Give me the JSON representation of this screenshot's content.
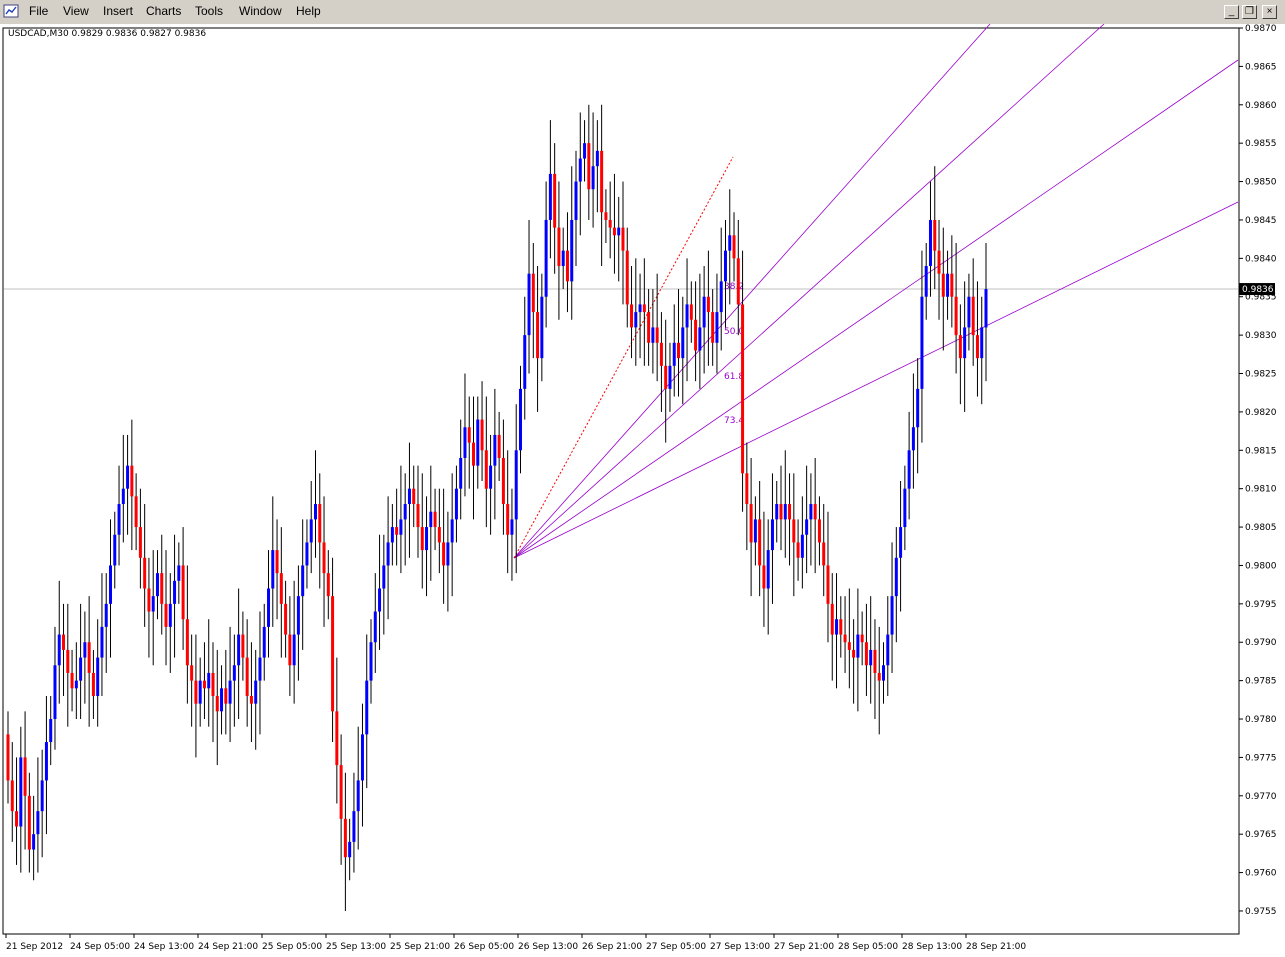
{
  "menu": {
    "items": [
      "File",
      "View",
      "Insert",
      "Charts",
      "Tools",
      "Window",
      "Help"
    ]
  },
  "window_controls": {
    "minimize": "_",
    "restore": "❐",
    "close": "×"
  },
  "chart": {
    "symbol_info": "USDCAD,M30  0.9829 0.9836 0.9827 0.9836",
    "current_price_label": "0.9836",
    "current_price": 0.9836
  },
  "colors": {
    "bull": "#0000ff",
    "bear": "#ff0000",
    "fib": "#9900cc",
    "trend": "#ff0000",
    "grid_line": "#c0c0c0"
  },
  "chart_data": {
    "type": "candlestick",
    "symbol": "USDCAD",
    "timeframe": "M30",
    "ylim": [
      0.9752,
      0.987
    ],
    "yticks": [
      "0.9870",
      "0.9865",
      "0.9860",
      "0.9855",
      "0.9850",
      "0.9845",
      "0.9840",
      "0.9835",
      "0.9830",
      "0.9825",
      "0.9820",
      "0.9815",
      "0.9810",
      "0.9805",
      "0.9800",
      "0.9795",
      "0.9790",
      "0.9785",
      "0.9780",
      "0.9775",
      "0.9770",
      "0.9765",
      "0.9760",
      "0.9755"
    ],
    "xticks": [
      "21 Sep 2012",
      "24 Sep 05:00",
      "24 Sep 13:00",
      "24 Sep 21:00",
      "25 Sep 05:00",
      "25 Sep 13:00",
      "25 Sep 21:00",
      "26 Sep 05:00",
      "26 Sep 13:00",
      "26 Sep 21:00",
      "27 Sep 05:00",
      "27 Sep 13:00",
      "27 Sep 21:00",
      "28 Sep 05:00",
      "28 Sep 13:00",
      "28 Sep 21:00"
    ],
    "closes": [
      0.9772,
      0.9768,
      0.9766,
      0.9775,
      0.977,
      0.9763,
      0.9765,
      0.9768,
      0.9772,
      0.9777,
      0.978,
      0.9787,
      0.9791,
      0.9789,
      0.9786,
      0.9784,
      0.9785,
      0.9788,
      0.979,
      0.9786,
      0.9783,
      0.9788,
      0.9792,
      0.9795,
      0.98,
      0.9804,
      0.9808,
      0.981,
      0.9813,
      0.9809,
      0.9805,
      0.9801,
      0.9797,
      0.9794,
      0.9796,
      0.9799,
      0.9795,
      0.9792,
      0.9795,
      0.9798,
      0.98,
      0.9793,
      0.9787,
      0.9785,
      0.9782,
      0.9785,
      0.9784,
      0.9786,
      0.9783,
      0.9781,
      0.9784,
      0.9782,
      0.9785,
      0.9787,
      0.9791,
      0.9788,
      0.9783,
      0.9782,
      0.9785,
      0.9788,
      0.9792,
      0.9797,
      0.9802,
      0.9799,
      0.9795,
      0.9791,
      0.9787,
      0.9791,
      0.9796,
      0.98,
      0.9803,
      0.9806,
      0.9808,
      0.9803,
      0.9799,
      0.9796,
      0.9781,
      0.9774,
      0.9767,
      0.9762,
      0.9764,
      0.9768,
      0.9772,
      0.9778,
      0.9785,
      0.979,
      0.9794,
      0.9797,
      0.98,
      0.9803,
      0.9805,
      0.9804,
      0.9806,
      0.9808,
      0.981,
      0.9808,
      0.9805,
      0.9802,
      0.9805,
      0.9807,
      0.9805,
      0.9803,
      0.98,
      0.9803,
      0.9806,
      0.981,
      0.9814,
      0.9818,
      0.9816,
      0.9813,
      0.9819,
      0.9815,
      0.981,
      0.9813,
      0.9817,
      0.9814,
      0.9808,
      0.9804,
      0.9806,
      0.9815,
      0.9823,
      0.983,
      0.9838,
      0.9833,
      0.9827,
      0.9835,
      0.9845,
      0.9851,
      0.9844,
      0.9839,
      0.9841,
      0.9837,
      0.9845,
      0.985,
      0.9853,
      0.9855,
      0.9849,
      0.9852,
      0.9854,
      0.9846,
      0.9845,
      0.9844,
      0.9843,
      0.9844,
      0.9841,
      0.9834,
      0.9831,
      0.9833,
      0.9834,
      0.9833,
      0.9829,
      0.9831,
      0.9829,
      0.9826,
      0.9823,
      0.9826,
      0.9829,
      0.9827,
      0.9831,
      0.9834,
      0.9832,
      0.9828,
      0.9831,
      0.9835,
      0.9833,
      0.9829,
      0.9833,
      0.9837,
      0.9841,
      0.9843,
      0.984,
      0.9834,
      0.9812,
      0.9808,
      0.9803,
      0.9806,
      0.98,
      0.9797,
      0.9802,
      0.9806,
      0.9808,
      0.9806,
      0.9808,
      0.9806,
      0.9803,
      0.9801,
      0.9804,
      0.9806,
      0.9808,
      0.9806,
      0.9803,
      0.98,
      0.9795,
      0.9791,
      0.9793,
      0.9791,
      0.979,
      0.9789,
      0.9788,
      0.9791,
      0.979,
      0.9787,
      0.9789,
      0.9786,
      0.9785,
      0.9787,
      0.9791,
      0.9796,
      0.9801,
      0.9805,
      0.981,
      0.9815,
      0.9818,
      0.9823,
      0.9835,
      0.9839,
      0.9845,
      0.9841,
      0.9838,
      0.9835,
      0.9838,
      0.9835,
      0.983,
      0.9827,
      0.9831,
      0.9835,
      0.983,
      0.9827,
      0.9831,
      0.9836
    ]
  },
  "fib_fan": {
    "labels": [
      "38.2",
      "50.0",
      "61.8",
      "73.4"
    ]
  }
}
